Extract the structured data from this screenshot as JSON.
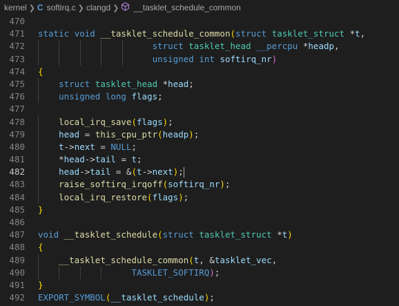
{
  "breadcrumb": {
    "folder": "kernel",
    "file": "softirq.c",
    "server": "clangd",
    "symbol": "__tasklet_schedule_common"
  },
  "icons": {
    "file": "c-file-icon",
    "symbol": "function-symbol-icon",
    "separator": "chevron-right-icon"
  },
  "colors": {
    "background": "#1e1e1e",
    "keyword": "#569cd6",
    "type": "#4ec9b0",
    "function": "#dcdcaa",
    "variable": "#9cdcfe",
    "plain": "#d4d4d4",
    "line_number": "#858585"
  },
  "editor": {
    "active_line": "482",
    "lines": [
      {
        "n": "470",
        "t": ""
      },
      {
        "n": "471",
        "t": "static void __tasklet_schedule_common(struct tasklet_struct *t,"
      },
      {
        "n": "472",
        "t": "                      struct tasklet_head __percpu *headp,"
      },
      {
        "n": "473",
        "t": "                      unsigned int softirq_nr)"
      },
      {
        "n": "474",
        "t": "{"
      },
      {
        "n": "475",
        "t": "    struct tasklet_head *head;"
      },
      {
        "n": "476",
        "t": "    unsigned long flags;"
      },
      {
        "n": "477",
        "t": ""
      },
      {
        "n": "478",
        "t": "    local_irq_save(flags);"
      },
      {
        "n": "479",
        "t": "    head = this_cpu_ptr(headp);"
      },
      {
        "n": "480",
        "t": "    t->next = NULL;"
      },
      {
        "n": "481",
        "t": "    *head->tail = t;"
      },
      {
        "n": "482",
        "t": "    head->tail = &(t->next);"
      },
      {
        "n": "483",
        "t": "    raise_softirq_irqoff(softirq_nr);"
      },
      {
        "n": "484",
        "t": "    local_irq_restore(flags);"
      },
      {
        "n": "485",
        "t": "}"
      },
      {
        "n": "486",
        "t": ""
      },
      {
        "n": "487",
        "t": "void __tasklet_schedule(struct tasklet_struct *t)"
      },
      {
        "n": "488",
        "t": "{"
      },
      {
        "n": "489",
        "t": "    __tasklet_schedule_common(t, &tasklet_vec,"
      },
      {
        "n": "490",
        "t": "                  TASKLET_SOFTIRQ);"
      },
      {
        "n": "491",
        "t": "}"
      },
      {
        "n": "492",
        "t": "EXPORT_SYMBOL(__tasklet_schedule);"
      }
    ]
  }
}
